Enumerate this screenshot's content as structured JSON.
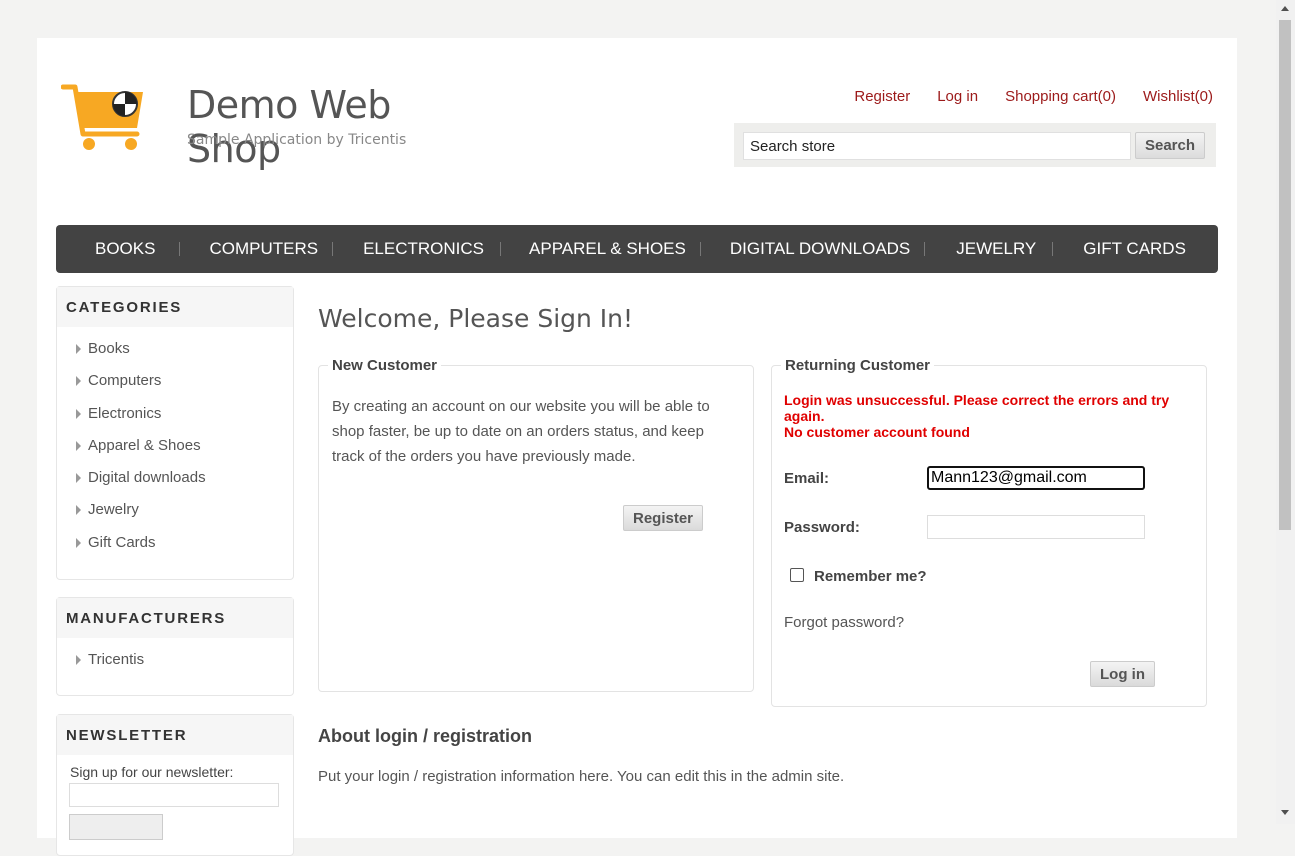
{
  "header": {
    "logo_title": "Demo Web Shop",
    "logo_subtitle": "Sample Application by Tricentis",
    "links": [
      "Register",
      "Log in",
      "Shopping cart(0)",
      "Wishlist(0)"
    ],
    "search_placeholder": "Search store",
    "search_button": "Search"
  },
  "topmenu": [
    "BOOKS",
    "COMPUTERS",
    "ELECTRONICS",
    "APPAREL & SHOES",
    "DIGITAL DOWNLOADS",
    "JEWELRY",
    "GIFT CARDS"
  ],
  "sidebar": {
    "categories_title": "CATEGORIES",
    "categories": [
      "Books",
      "Computers",
      "Electronics",
      "Apparel & Shoes",
      "Digital downloads",
      "Jewelry",
      "Gift Cards"
    ],
    "manufacturers_title": "MANUFACTURERS",
    "manufacturers": [
      "Tricentis"
    ],
    "newsletter_title": "NEWSLETTER",
    "newsletter_label": "Sign up for our newsletter:"
  },
  "main": {
    "page_title": "Welcome, Please Sign In!",
    "new_customer": {
      "title": "New Customer",
      "text": "By creating an account on our website you will be able to shop faster, be up to date on an orders status, and keep track of the orders you have previously made.",
      "register_button": "Register"
    },
    "returning_customer": {
      "title": "Returning Customer",
      "error_line1": "Login was unsuccessful. Please correct the errors and try again.",
      "error_line2": "No customer account found",
      "email_label": "Email:",
      "email_value": "Mann123@gmail.com",
      "password_label": "Password:",
      "remember_label": "Remember me?",
      "forgot_link": "Forgot password?",
      "login_button": "Log in"
    },
    "about_title": "About login / registration",
    "about_text": "Put your login / registration information here. You can edit this in the admin site."
  },
  "colors": {
    "link_red": "#9c1a1a",
    "menu_bg": "#434343",
    "error_red": "#e00000",
    "logo_orange": "#f7a823"
  }
}
